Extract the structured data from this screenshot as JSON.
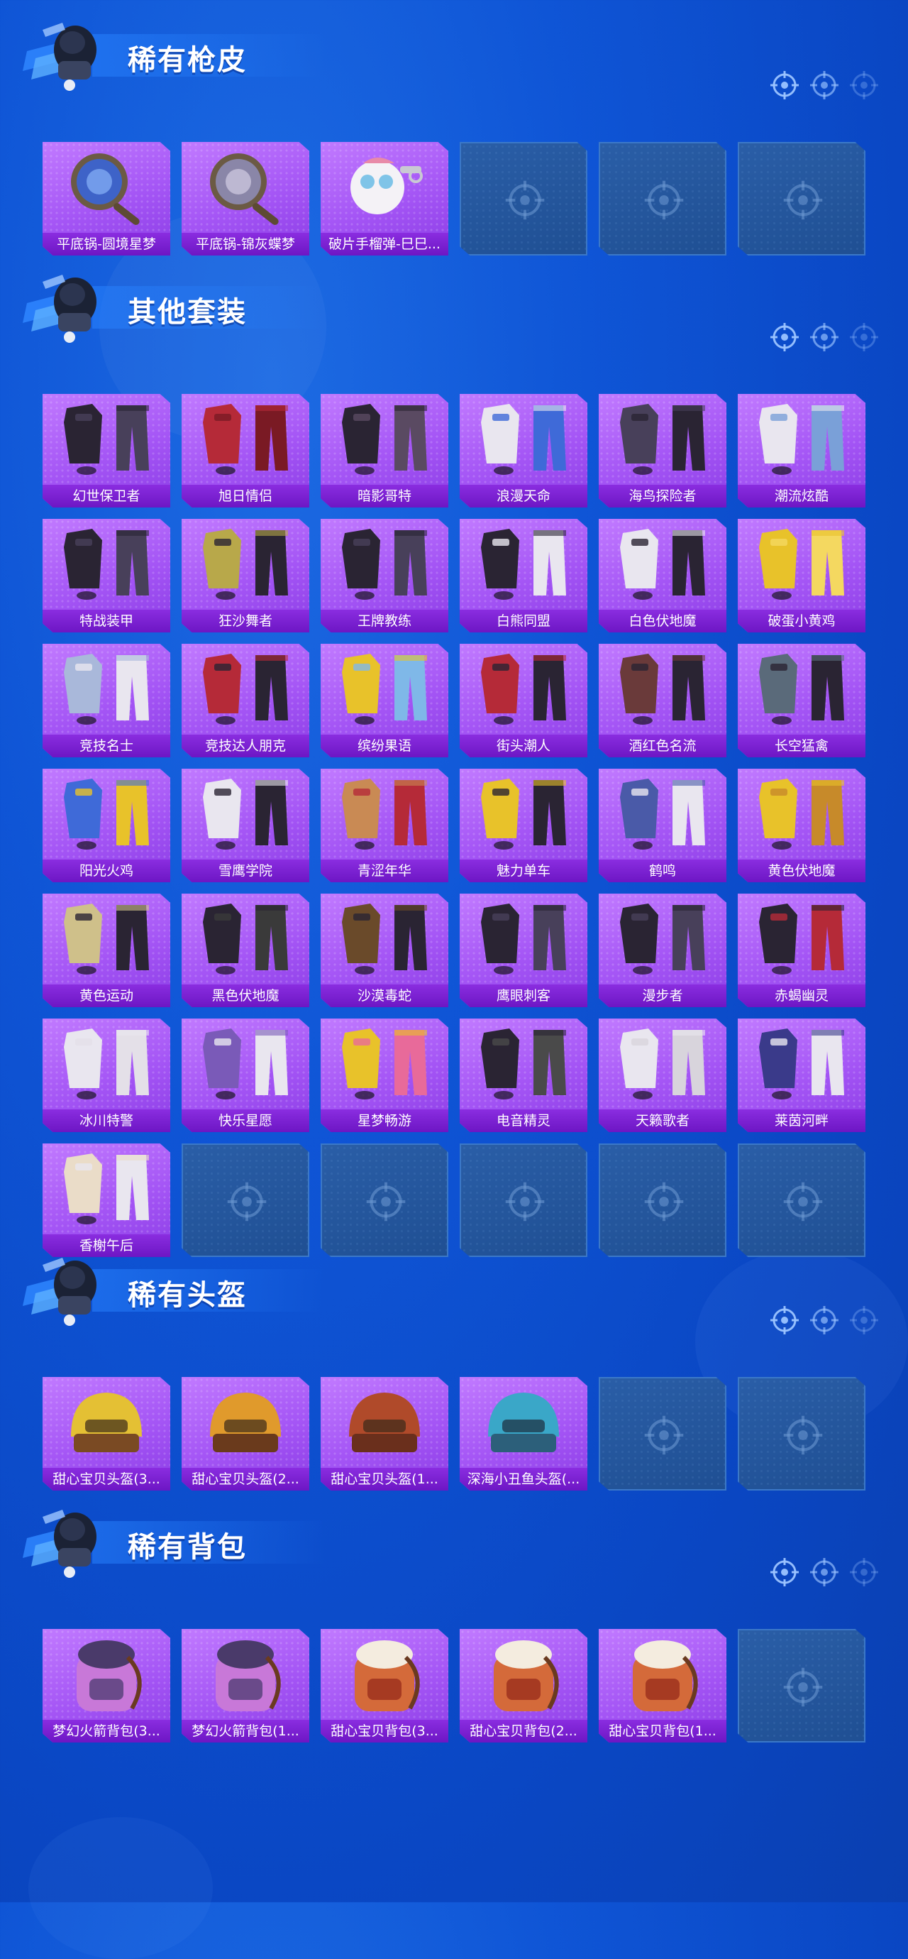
{
  "sections": [
    {
      "title": "稀有枪皮",
      "items": [
        "平底锅-圆境星梦",
        "平底锅-锦灰蝶梦",
        "破片手榴弹-巳巳..."
      ],
      "item_icons": [
        "pan-icon",
        "pan-icon",
        "grenade-icon"
      ],
      "empty_slots": 3
    },
    {
      "title": "其他套装",
      "items": [
        "幻世保卫者",
        "旭日情侣",
        "暗影哥特",
        "浪漫天命",
        "海鸟探险者",
        "潮流炫酷",
        "特战装甲",
        "狂沙舞者",
        "王牌教练",
        "白熊同盟",
        "白色伏地魔",
        "破蛋小黄鸡",
        "竞技名士",
        "竞技达人朋克",
        "缤纷果语",
        "街头潮人",
        "酒红色名流",
        "长空猛禽",
        "阳光火鸡",
        "雪鹰学院",
        "青涩年华",
        "魅力单车",
        "鹤鸣",
        "黄色伏地魔",
        "黄色运动",
        "黑色伏地魔",
        "沙漠毒蛇",
        "鹰眼刺客",
        "漫步者",
        "赤蝎幽灵",
        "冰川特警",
        "快乐星愿",
        "星梦畅游",
        "电音精灵",
        "天籁歌者",
        "莱茵河畔",
        "香榭午后"
      ],
      "item_icons": [
        "outfit-icon"
      ],
      "empty_slots": 5
    },
    {
      "title": "稀有头盔",
      "items": [
        "甜心宝贝头盔(3...",
        "甜心宝贝头盔(2...",
        "甜心宝贝头盔(1...",
        "深海小丑鱼头盔(..."
      ],
      "item_icons": [
        "helmet-icon"
      ],
      "empty_slots": 2
    },
    {
      "title": "稀有背包",
      "items": [
        "梦幻火箭背包(3...",
        "梦幻火箭背包(1...",
        "甜心宝贝背包(3...",
        "甜心宝贝背包(2...",
        "甜心宝贝背包(1..."
      ],
      "item_icons": [
        "backpack-icon"
      ],
      "empty_slots": 1
    }
  ],
  "colors": {
    "background": "#0f55d6",
    "card_purple": "#a455f5",
    "label_purple": "#7a1fd0",
    "empty_slot": "#245699"
  },
  "icons": {
    "section_emblem": "soldier-emblem-icon",
    "header_decoration": "crosshair-icon",
    "empty_slot": "crosshair-icon"
  }
}
